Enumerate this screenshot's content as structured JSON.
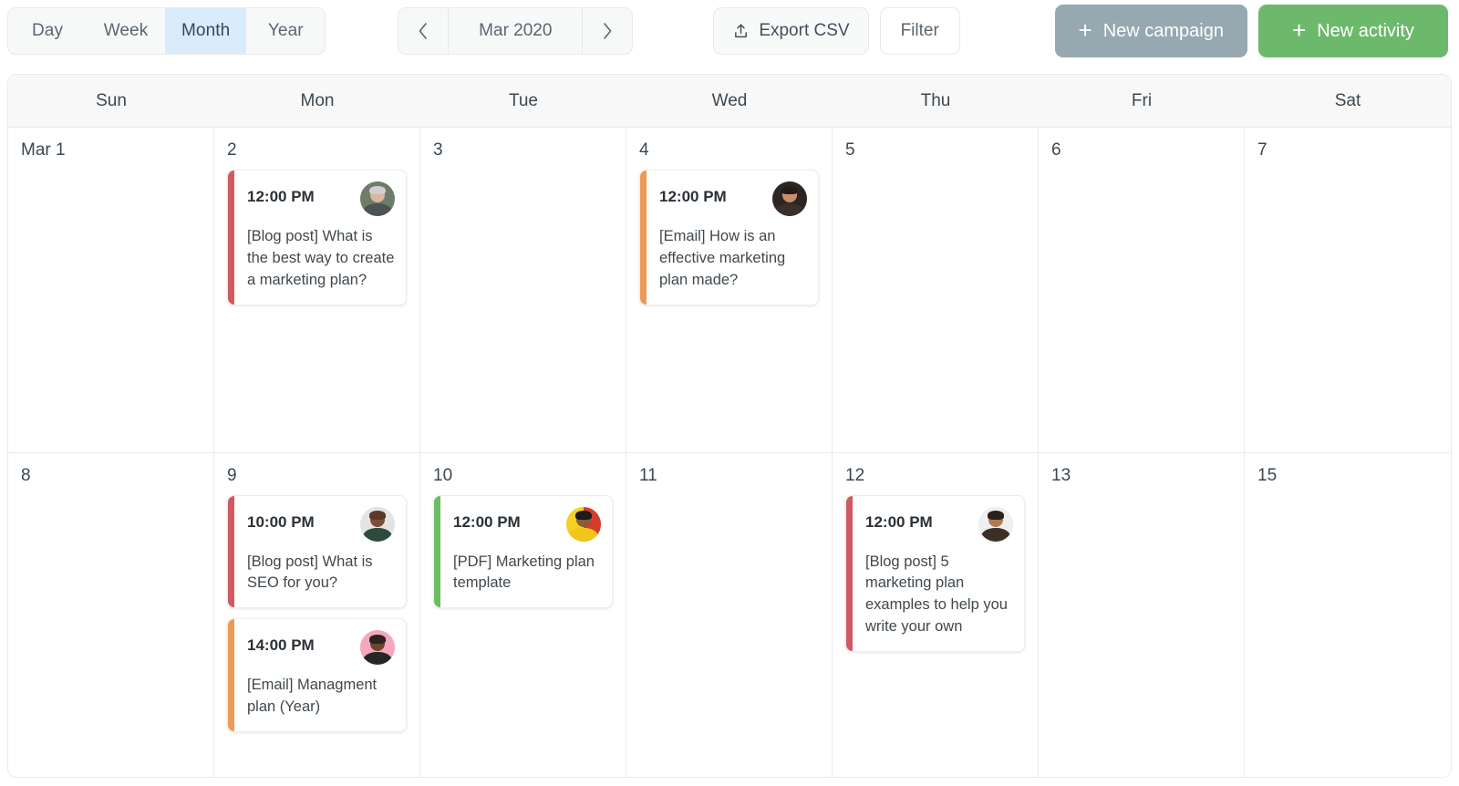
{
  "toolbar": {
    "view_tabs": [
      {
        "label": "Day",
        "active": false
      },
      {
        "label": "Week",
        "active": false
      },
      {
        "label": "Month",
        "active": true
      },
      {
        "label": "Year",
        "active": false
      }
    ],
    "prev_icon": "chevron-left-icon",
    "next_icon": "chevron-right-icon",
    "period_label": "Mar 2020",
    "export_icon": "upload-icon",
    "export_label": "Export CSV",
    "filter_label": "Filter",
    "new_campaign_label": "New campaign",
    "new_activity_label": "New activity",
    "plus_glyph": "+",
    "colors": {
      "active_tab_bg": "#d9ecfb",
      "campaign_btn": "#96a8b0",
      "activity_btn": "#6cb96c"
    }
  },
  "calendar": {
    "day_headers": [
      "Sun",
      "Mon",
      "Tue",
      "Wed",
      "Thu",
      "Fri",
      "Sat"
    ],
    "accent_colors": {
      "blog": "#cf5a62",
      "email": "#ef9a54",
      "pdf": "#6cbd63"
    },
    "weeks": [
      {
        "days": [
          {
            "num": "Mar 1",
            "events": []
          },
          {
            "num": "2",
            "events": [
              {
                "time": "12:00 PM",
                "title": "[Blog post] What is the best way to create a marketing plan?",
                "type": "blog",
                "accent": "#cf5a62",
                "avatar": {
                  "name": "avatar-woman-grey-hair",
                  "bg": "#6f7c6a",
                  "skin": "#d9b7a0",
                  "hair": "#cfcfcf",
                  "body": "#4a5455"
                }
              }
            ]
          },
          {
            "num": "3",
            "events": []
          },
          {
            "num": "4",
            "events": [
              {
                "time": "12:00 PM",
                "title": "[Email] How is an effective marketing plan made?",
                "type": "email",
                "accent": "#ef9a54",
                "avatar": {
                  "name": "avatar-woman-dark-hair",
                  "bg": "#2b2623",
                  "skin": "#c98f6e",
                  "hair": "#241c18",
                  "body": "#3a2f2a"
                }
              }
            ]
          },
          {
            "num": "5",
            "events": []
          },
          {
            "num": "6",
            "events": []
          },
          {
            "num": "7",
            "events": []
          }
        ]
      },
      {
        "days": [
          {
            "num": "8",
            "events": []
          },
          {
            "num": "9",
            "events": [
              {
                "time": "10:00 PM",
                "title": "[Blog post] What is SEO for you?",
                "type": "blog",
                "accent": "#cf5a62",
                "avatar": {
                  "name": "avatar-man-bald",
                  "bg": "#e4e4e4",
                  "skin": "#7a5038",
                  "hair": "#5b3a27",
                  "body": "#2f4a3c"
                }
              },
              {
                "time": "14:00 PM",
                "title": "[Email] Managment plan (Year)",
                "type": "email",
                "accent": "#ef9a54",
                "avatar": {
                  "name": "avatar-man-beard-pink-bg",
                  "bg": "#f5a8bd",
                  "skin": "#6d4630",
                  "hair": "#2a2320",
                  "body": "#262626"
                }
              }
            ]
          },
          {
            "num": "10",
            "events": [
              {
                "time": "12:00 PM",
                "title": "[PDF] Marketing plan template",
                "type": "pdf",
                "accent": "#6cbd63",
                "avatar": {
                  "name": "avatar-woman-yellow-red-bg",
                  "bg": "#f5d020",
                  "bg2": "#d93b2b",
                  "skin": "#8a5b3a",
                  "hair": "#1d1a18",
                  "body": "#f2c518"
                }
              }
            ]
          },
          {
            "num": "11",
            "events": []
          },
          {
            "num": "12",
            "events": [
              {
                "time": "12:00 PM",
                "title": "[Blog post] 5 marketing plan examples to help you write your own",
                "type": "blog",
                "accent": "#cf5a62",
                "avatar": {
                  "name": "avatar-man-curly-hair",
                  "bg": "#efefef",
                  "skin": "#b07a52",
                  "hair": "#2b211c",
                  "body": "#3b2f28"
                }
              }
            ]
          },
          {
            "num": "13",
            "events": []
          },
          {
            "num": "15",
            "events": []
          }
        ]
      }
    ]
  }
}
